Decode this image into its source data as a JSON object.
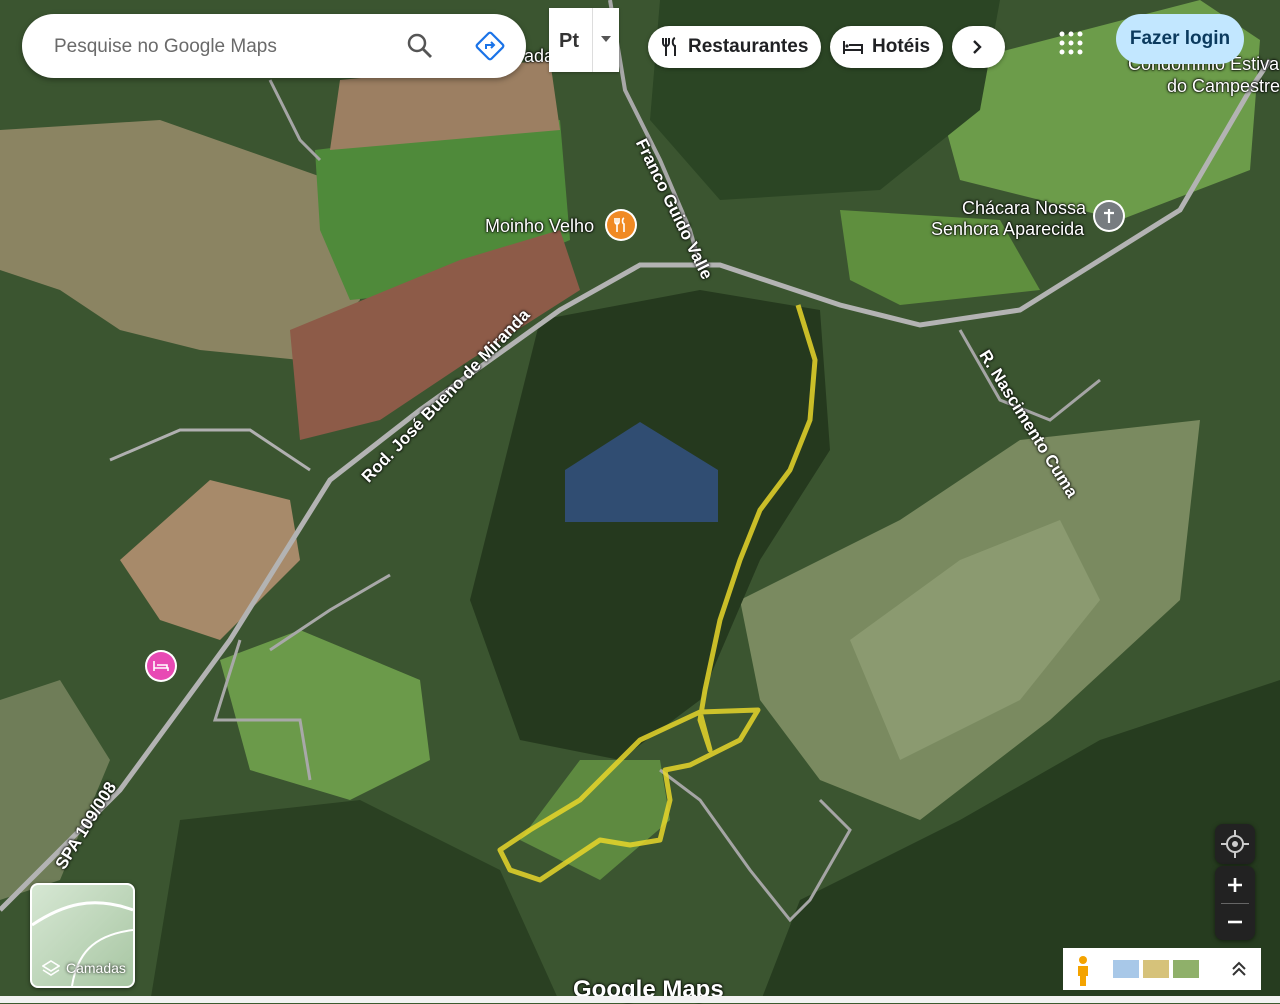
{
  "search": {
    "placeholder": "Pesquise no Google Maps"
  },
  "language_button": {
    "label": "Pt"
  },
  "chips": [
    {
      "label": "Restaurantes",
      "icon": "restaurant-icon"
    },
    {
      "label": "Hotéis",
      "icon": "hotel-icon"
    }
  ],
  "login": {
    "label": "Fazer login"
  },
  "places": {
    "moinho": "Moinho Velho",
    "chacara_line1": "Chácara Nossa",
    "chacara_line2": "Senhora Aparecida",
    "condominio_line1": "Condomínio Estiva",
    "condominio_line2": "do Campestre",
    "partial": "ada"
  },
  "roads": {
    "franco": "Franco Guido Valle",
    "jose_bueno": "Rod. José Bueno de Miranda",
    "nascimento": "R. Nascimento Cuma",
    "spa": "SPA 109/008"
  },
  "layers": {
    "label": "Camadas"
  },
  "branding": {
    "logo": "Google Maps"
  },
  "colors": {
    "route": "#e8d62a",
    "forest": "#2c4a26",
    "field": "#6f9a4c",
    "road": "#b0b0b0",
    "login_bg": "#c2e7ff",
    "restaurant_pin": "#f08a24",
    "hotel_pin": "#e84ab4"
  }
}
